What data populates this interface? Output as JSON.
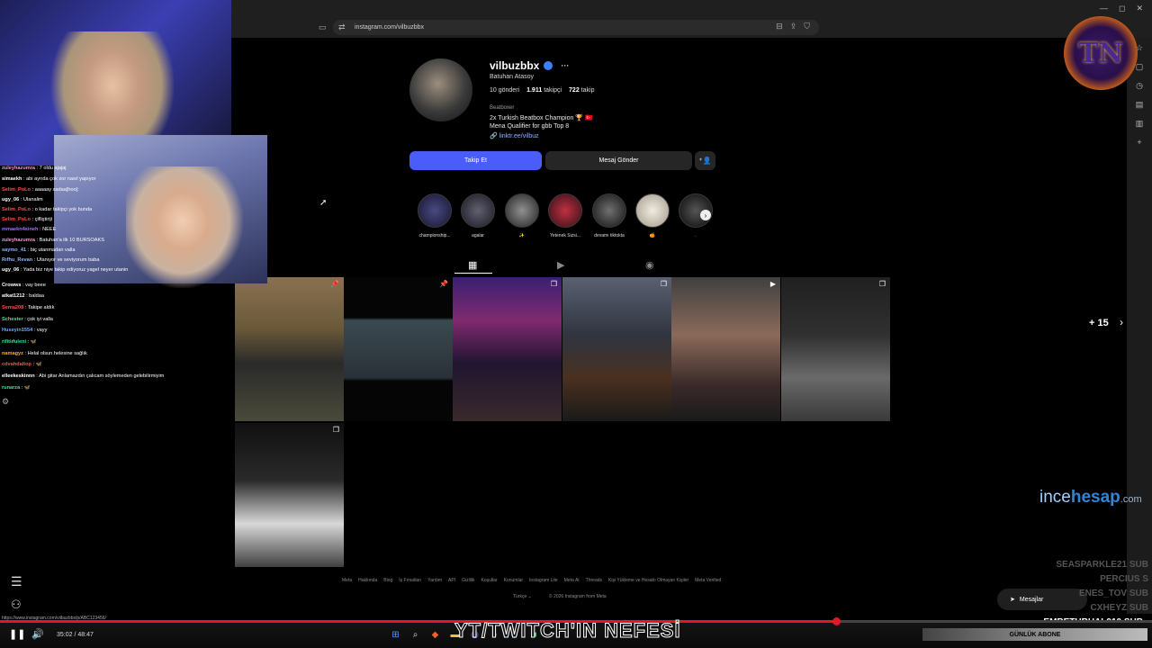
{
  "browser": {
    "url": "instagram.com/vilbuzbbx",
    "colors": {
      "chrome_bg": "#1f1f1f",
      "accent": "#4a5df9"
    }
  },
  "profile": {
    "username": "vilbuzbbx",
    "full_name": "Batuhan Atasoy",
    "posts_label": "10 gönderi",
    "followers_count": "1.911",
    "followers_label": "takipçi",
    "following_count": "722",
    "following_label": "takip",
    "category": "Beatboxer",
    "bio_line1": "2x Turkish Beatbox Champion 🏆 🇹🇷",
    "bio_line2": "Mena Qualifier for gbb Top 8",
    "link": "linktr.ee/vilbuz",
    "follow_button": "Takip Et",
    "message_button": "Mesaj Gönder",
    "suggest_icon": "add-person-icon"
  },
  "highlights": [
    {
      "label": "championship..."
    },
    {
      "label": "agalar"
    },
    {
      "label": "✨"
    },
    {
      "label": "Yetenek Sizsi..."
    },
    {
      "label": "devamı tiktokta"
    },
    {
      "label": "🍊"
    },
    {
      "label": "."
    }
  ],
  "grid_overlay": {
    "more_count": "+ 15"
  },
  "footer": {
    "links": [
      "Meta",
      "Hakkında",
      "Blog",
      "İş Fırsatları",
      "Yardım",
      "API",
      "Gizlilik",
      "Koşullar",
      "Konumlar",
      "Instagram Lite",
      "Meta AI",
      "Threads",
      "Kişi Yükleme ve Hesabı Olmayan Kişiler",
      "Meta Verified"
    ],
    "language": "Türkçe ⌄",
    "copyright": "© 2026 Instagram from Meta"
  },
  "messages_button": "Mesajlar",
  "chat": [
    {
      "user": "zuleyhazumra",
      "text": ": 7 oldu ajajaj",
      "color": "#ff8fd8"
    },
    {
      "user": "simaekh",
      "text": ": abi ayrıda çok zor nasıl yapıyor",
      "color": "#ffffff"
    },
    {
      "user": "Selim_PoLo",
      "text": ": aaaaay sadaa[hoo]:",
      "color": "#ff4d4d"
    },
    {
      "user": "ugy_06",
      "text": ": Ulanalim",
      "color": "#ffffff"
    },
    {
      "user": "Selim_PoLo",
      "text": ": o kadar takipçi yok bunda",
      "color": "#ff4d4d"
    },
    {
      "user": "Selim_PoLo",
      "text": ": çifliştiriji",
      "color": "#ff4d4d"
    },
    {
      "user": "mmaekn4sineh",
      "text": ": NEEE",
      "color": "#a070ff"
    },
    {
      "user": "zuleyhazumra",
      "text": ": Batuhan'a ilk 10 BURSOAKS",
      "color": "#ff8fd8"
    },
    {
      "user": "saymo_41",
      "text": ": biç utanmadan valla",
      "color": "#8fb8ff"
    },
    {
      "user": "Rıfhu_Revan",
      "text": ": Utanıyor ve seviyorum baba",
      "color": "#8fb8ff"
    },
    {
      "user": "ugy_06",
      "text": ": Yada biz niye takip ediyoruz yagel neyer utanin",
      "color": "#ffffff"
    },
    {
      "user": "Crowws",
      "text": ": vay beee",
      "color": "#ffffff"
    },
    {
      "user": "atkat1212",
      "text": ": baldaa",
      "color": "#ffffff"
    },
    {
      "user": "Sema208",
      "text": ": Takipe aldık",
      "color": "#ff4d4d"
    },
    {
      "user": "Schester",
      "text": ": çok iyi valla",
      "color": "#40e0a0"
    },
    {
      "user": "Huseyin1554",
      "text": ": vayy",
      "color": "#6fa8ff"
    },
    {
      "user": "rifitiıfuleni",
      "text": ": 🦋",
      "color": "#40e0a0"
    },
    {
      "user": "namagyz",
      "text": ": Helal olsun helesine sağlık",
      "color": "#ffb000"
    },
    {
      "user": "cdvahdaltop",
      "text": ": 🦋",
      "color": "#ff4d4d"
    },
    {
      "user": "elleekeskinnn",
      "text": ": Abi gitar Anlamazdın çalıcam söylemeden gelebilirmiyim",
      "color": "#ffffff"
    },
    {
      "user": "runarza",
      "text": ": 🦋",
      "color": "#40e0a0"
    }
  ],
  "overlay": {
    "logo_text": "TN",
    "sponsor_main": "ince",
    "sponsor_bold": "hesap",
    "sponsor_tld": ".com",
    "sub_names": [
      "SEASPARKLE21  SUB",
      "PERCIUS  S",
      "ENES_TOV  SUB",
      "CXHEYZ  SUB"
    ],
    "latest_sub": "EMRETURHAL910  SUB",
    "banner": "YT/TWITCH'IN NEFESİ",
    "daily_sub": "GÜNLÜK ABONE"
  },
  "player": {
    "time": "35:02 / 48:47",
    "progress": 0.726,
    "status_url": "https://www.instagram.com/vilbuzbbx/p/ABC123456/"
  }
}
